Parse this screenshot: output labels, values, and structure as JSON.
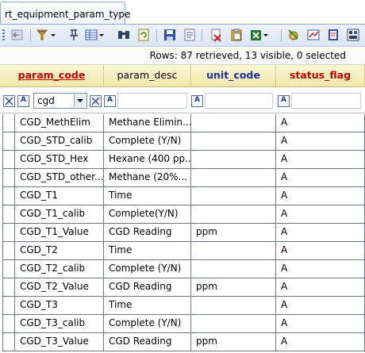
{
  "tab": {
    "title": "rt_equipment_param_type"
  },
  "toolbar": {
    "icons": [
      "back-icon",
      "filter-icon",
      "pin-icon",
      "columns-icon",
      "find-icon",
      "refresh-icon",
      "save-icon",
      "properties-icon",
      "delete-icon",
      "paste-icon",
      "excel-icon",
      "settings-icon",
      "chart-icon",
      "report-icon",
      "grid-icon"
    ]
  },
  "status": {
    "text": "Rows: 87 retrieved, 13 visible, 0 selected"
  },
  "columns": [
    {
      "label": "param_code",
      "color": "#c00000",
      "underline": true
    },
    {
      "label": "param_desc",
      "color": "#000000",
      "underline": false
    },
    {
      "label": "unit_code",
      "color": "#1a2fa0",
      "underline": false
    },
    {
      "label": "status_flag",
      "color": "#c00000",
      "underline": false
    }
  ],
  "filter": {
    "param_code_value": "cgd"
  },
  "rows": [
    {
      "code": "CGD_MethElim",
      "desc": "Methane Elimin...",
      "unit": "",
      "status": "A"
    },
    {
      "code": "CGD_STD_calib",
      "desc": "Complete (Y/N)",
      "unit": "",
      "status": "A"
    },
    {
      "code": "CGD_STD_Hex",
      "desc": "Hexane (400 pp...",
      "unit": "",
      "status": "A"
    },
    {
      "code": "CGD_STD_other...",
      "desc": "Methane (20%...",
      "unit": "",
      "status": "A"
    },
    {
      "code": "CGD_T1",
      "desc": "Time",
      "unit": "",
      "status": "A"
    },
    {
      "code": "CGD_T1_calib",
      "desc": "Complete(Y/N)",
      "unit": "",
      "status": "A"
    },
    {
      "code": "CGD_T1_Value",
      "desc": "CGD Reading",
      "unit": "ppm",
      "status": "A"
    },
    {
      "code": "CGD_T2",
      "desc": "Time",
      "unit": "",
      "status": "A"
    },
    {
      "code": "CGD_T2_calib",
      "desc": "Complete (Y/N)",
      "unit": "",
      "status": "A"
    },
    {
      "code": "CGD_T2_Value",
      "desc": "CGD Reading",
      "unit": "ppm",
      "status": "A"
    },
    {
      "code": "CGD_T3",
      "desc": "Time",
      "unit": "",
      "status": "A"
    },
    {
      "code": "CGD_T3_calib",
      "desc": "Complete (Y/N)",
      "unit": "",
      "status": "A"
    },
    {
      "code": "CGD_T3_Value",
      "desc": "CGD Reading",
      "unit": "ppm",
      "status": "A"
    }
  ]
}
